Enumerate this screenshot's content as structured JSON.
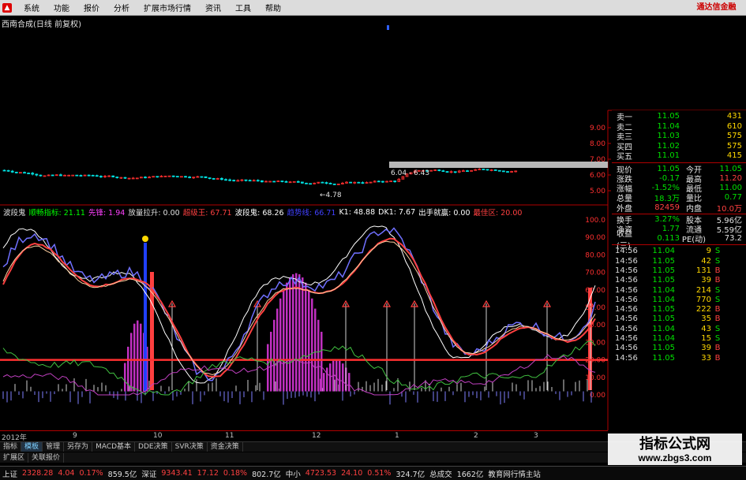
{
  "menu": {
    "items": [
      "系统",
      "功能",
      "报价",
      "分析",
      "扩展市场行情",
      "资讯",
      "工具",
      "帮助"
    ],
    "brand": "通达信金融"
  },
  "chart": {
    "title": "西南合成(日线 前复权)",
    "price_axis": [
      "9.00",
      "8.00",
      "7.00",
      "6.00",
      "5.00"
    ],
    "low_label": "4.78",
    "range_label": "6.04 - 6.43",
    "ind_axis": [
      "100.0",
      "90.00",
      "80.00",
      "70.00",
      "60.00",
      "50.00",
      "40.00",
      "30.00",
      "20.00",
      "10.00",
      "0.00"
    ],
    "dates": [
      "2012年",
      "9",
      "10",
      "11",
      "12",
      "1",
      "2",
      "3"
    ],
    "colors": {
      "up": "#ff3030",
      "down": "#00e0e0",
      "bg": "#000000",
      "grid": "#b00000"
    }
  },
  "indicators": [
    {
      "name": "波段鬼",
      "color": "#e0e0e0"
    },
    {
      "name": "顺畅指标: 21.11",
      "color": "#00ff00"
    },
    {
      "name": "先锋: 1.94",
      "color": "#ff40ff"
    },
    {
      "name": "放量拉升: 0.00",
      "color": "#e0e0e0"
    },
    {
      "name": "超级王: 67.71",
      "color": "#ff4040"
    },
    {
      "name": "波段鬼: 68.26",
      "color": "#ffffff"
    },
    {
      "name": "趋势线: 66.71",
      "color": "#4040ff"
    },
    {
      "name": "K1: 48.88",
      "color": "#ffffff"
    },
    {
      "name": "DK1: 7.67",
      "color": "#ffffff"
    },
    {
      "name": "出手就赢: 0.00",
      "color": "#ffffff"
    },
    {
      "name": "最佳区: 20.00",
      "color": "#ff4040"
    }
  ],
  "quotes": {
    "book": [
      {
        "label": "卖一",
        "price": "11.05",
        "vol": "431"
      },
      {
        "label": "卖二",
        "price": "11.04",
        "vol": "610"
      },
      {
        "label": "卖三",
        "price": "11.03",
        "vol": "575"
      },
      {
        "label": "买四",
        "price": "11.02",
        "vol": "575"
      },
      {
        "label": "买五",
        "price": "11.01",
        "vol": "415"
      }
    ],
    "stats": [
      {
        "l1": "现价",
        "v1": "11.05",
        "l2": "今开",
        "v2": "11.05"
      },
      {
        "l1": "涨跌",
        "v1": "-0.17",
        "l2": "最高",
        "v2": "11.20"
      },
      {
        "l1": "涨幅",
        "v1": "-1.52%",
        "l2": "最低",
        "v2": "11.00"
      },
      {
        "l1": "总量",
        "v1": "18.3万",
        "l2": "量比",
        "v2": "0.77"
      },
      {
        "l1": "外盘",
        "v1": "82459",
        "l2": "内盘",
        "v2": "10.0万"
      },
      {
        "l1": "换手",
        "v1": "3.27%",
        "l2": "股本",
        "v2": "5.96亿"
      },
      {
        "l1": "净资",
        "v1": "1.77",
        "l2": "流通",
        "v2": "5.59亿"
      },
      {
        "l1": "收益(三)",
        "v1": "0.113",
        "l2": "PE(动)",
        "v2": "73.2"
      }
    ],
    "ticks": [
      {
        "time": "14:56",
        "price": "11.04",
        "vol": "9",
        "bs": "S"
      },
      {
        "time": "14:56",
        "price": "11.05",
        "vol": "42",
        "bs": "S"
      },
      {
        "time": "14:56",
        "price": "11.05",
        "vol": "131",
        "bs": "B"
      },
      {
        "time": "14:56",
        "price": "11.05",
        "vol": "39",
        "bs": "B"
      },
      {
        "time": "14:56",
        "price": "11.04",
        "vol": "214",
        "bs": "S"
      },
      {
        "time": "14:56",
        "price": "11.04",
        "vol": "770",
        "bs": "S"
      },
      {
        "time": "14:56",
        "price": "11.05",
        "vol": "222",
        "bs": "B"
      },
      {
        "time": "14:56",
        "price": "11.05",
        "vol": "35",
        "bs": "B"
      },
      {
        "time": "14:56",
        "price": "11.04",
        "vol": "43",
        "bs": "S"
      },
      {
        "time": "14:56",
        "price": "11.04",
        "vol": "15",
        "bs": "S"
      },
      {
        "time": "14:56",
        "price": "11.05",
        "vol": "39",
        "bs": "B"
      },
      {
        "time": "14:56",
        "price": "11.05",
        "vol": "33",
        "bs": "B"
      }
    ]
  },
  "tabs": [
    "指标",
    "模板",
    "管理",
    "另存为",
    "MACD基本",
    "DDE决策",
    "SVR决策",
    "资金决策"
  ],
  "tabs2": [
    "扩展区",
    "关联报价"
  ],
  "status": [
    {
      "text": "上证",
      "color": "#e0e0e0"
    },
    {
      "text": "2328.28",
      "color": "#ff4040"
    },
    {
      "text": "4.04",
      "color": "#ff4040"
    },
    {
      "text": "0.17%",
      "color": "#ff4040"
    },
    {
      "text": "859.5亿",
      "color": "#e0e0e0"
    },
    {
      "text": "深证",
      "color": "#e0e0e0"
    },
    {
      "text": "9343.41",
      "color": "#ff4040"
    },
    {
      "text": "17.12",
      "color": "#ff4040"
    },
    {
      "text": "0.18%",
      "color": "#ff4040"
    },
    {
      "text": "802.7亿",
      "color": "#e0e0e0"
    },
    {
      "text": "中小",
      "color": "#e0e0e0"
    },
    {
      "text": "4723.53",
      "color": "#ff4040"
    },
    {
      "text": "24.10",
      "color": "#ff4040"
    },
    {
      "text": "0.51%",
      "color": "#ff4040"
    },
    {
      "text": "324.7亿",
      "color": "#e0e0e0"
    },
    {
      "text": "总成交",
      "color": "#e0e0e0"
    },
    {
      "text": "1662亿",
      "color": "#e0e0e0"
    },
    {
      "text": "教育网行情主站",
      "color": "#e0e0e0"
    }
  ],
  "watermark": {
    "line1": "指标公式网",
    "line2": "www.zbgs3.com"
  }
}
